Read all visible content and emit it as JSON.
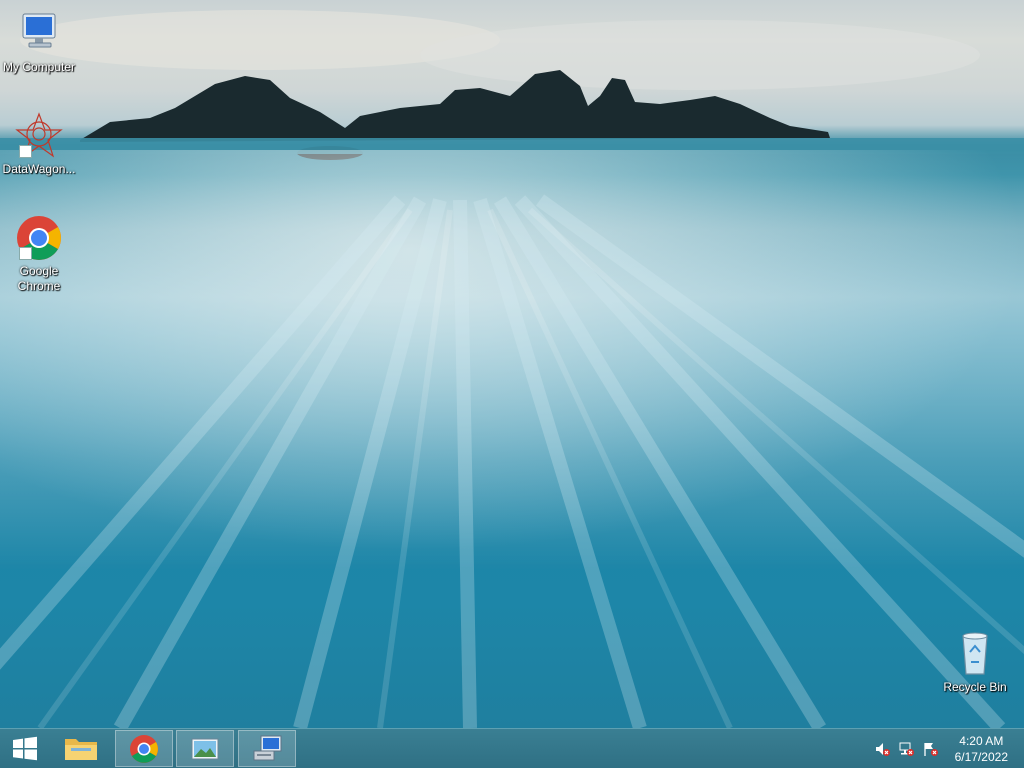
{
  "desktop": {
    "icons": [
      {
        "label": "My Computer",
        "icon": "computer-icon"
      },
      {
        "label": "DataWagon...",
        "icon": "datawagon-icon"
      },
      {
        "label": "Google Chrome",
        "icon": "chrome-icon"
      },
      {
        "label": "Recycle Bin",
        "icon": "recycle-bin-icon"
      }
    ]
  },
  "taskbar": {
    "start_icon": "windows-start-icon",
    "pinned": [
      {
        "name": "file-explorer",
        "icon": "folder-icon"
      },
      {
        "name": "chrome",
        "icon": "chrome-icon"
      },
      {
        "name": "photo-viewer",
        "icon": "picture-icon"
      },
      {
        "name": "remote-desktop",
        "icon": "computer-network-icon"
      }
    ],
    "tray": [
      {
        "icon": "speaker-muted-icon"
      },
      {
        "icon": "network-error-icon"
      },
      {
        "icon": "action-center-flag-icon"
      }
    ],
    "clock": {
      "time": "4:20 AM",
      "date": "6/17/2022"
    }
  },
  "colors": {
    "taskbar": "#347688",
    "sea": "#1d86a8",
    "sky": "#d4d9d7"
  }
}
